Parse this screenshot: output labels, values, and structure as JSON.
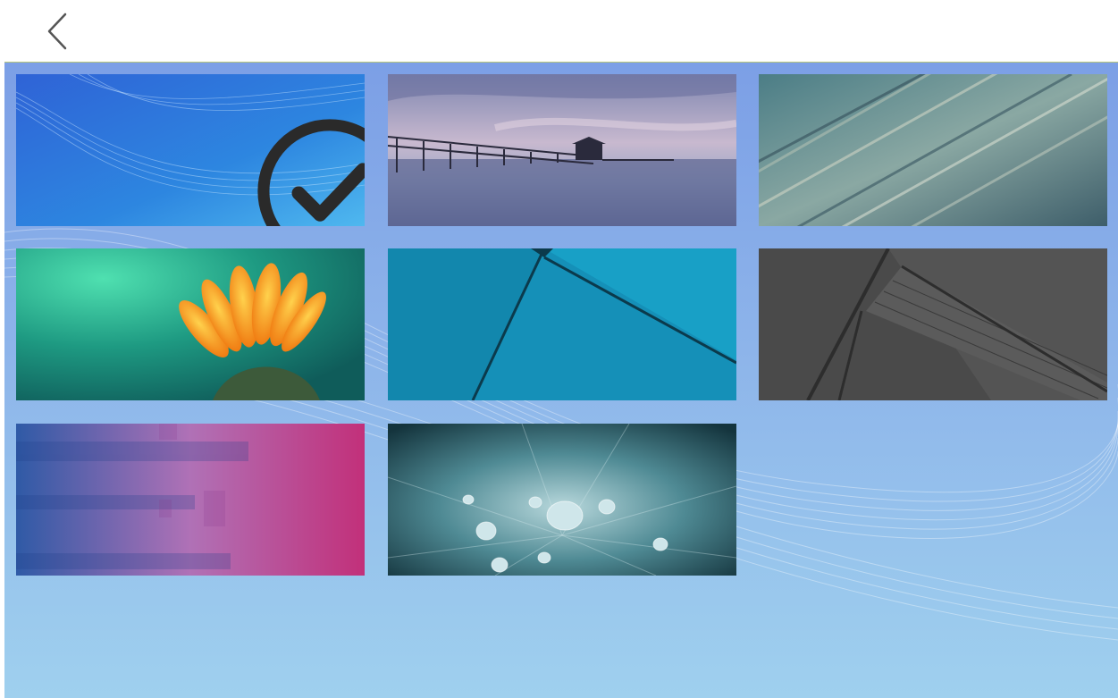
{
  "header": {
    "back_icon": "chevron-left-icon"
  },
  "wallpapers": [
    {
      "name": "blue-waves",
      "selected": true
    },
    {
      "name": "pier-seascape",
      "selected": false
    },
    {
      "name": "motion-streaks",
      "selected": false
    },
    {
      "name": "orange-flower",
      "selected": false
    },
    {
      "name": "teal-geometric",
      "selected": false
    },
    {
      "name": "dark-material",
      "selected": false
    },
    {
      "name": "pink-blue-blur",
      "selected": false
    },
    {
      "name": "water-droplets",
      "selected": false
    }
  ],
  "selection_icon": "checkmark-circle-icon",
  "colors": {
    "background_top": "#7c9fe6",
    "background_bottom": "#9fd0ee",
    "header_border": "#b9c87a",
    "check_icon": "#2a2a2a"
  }
}
